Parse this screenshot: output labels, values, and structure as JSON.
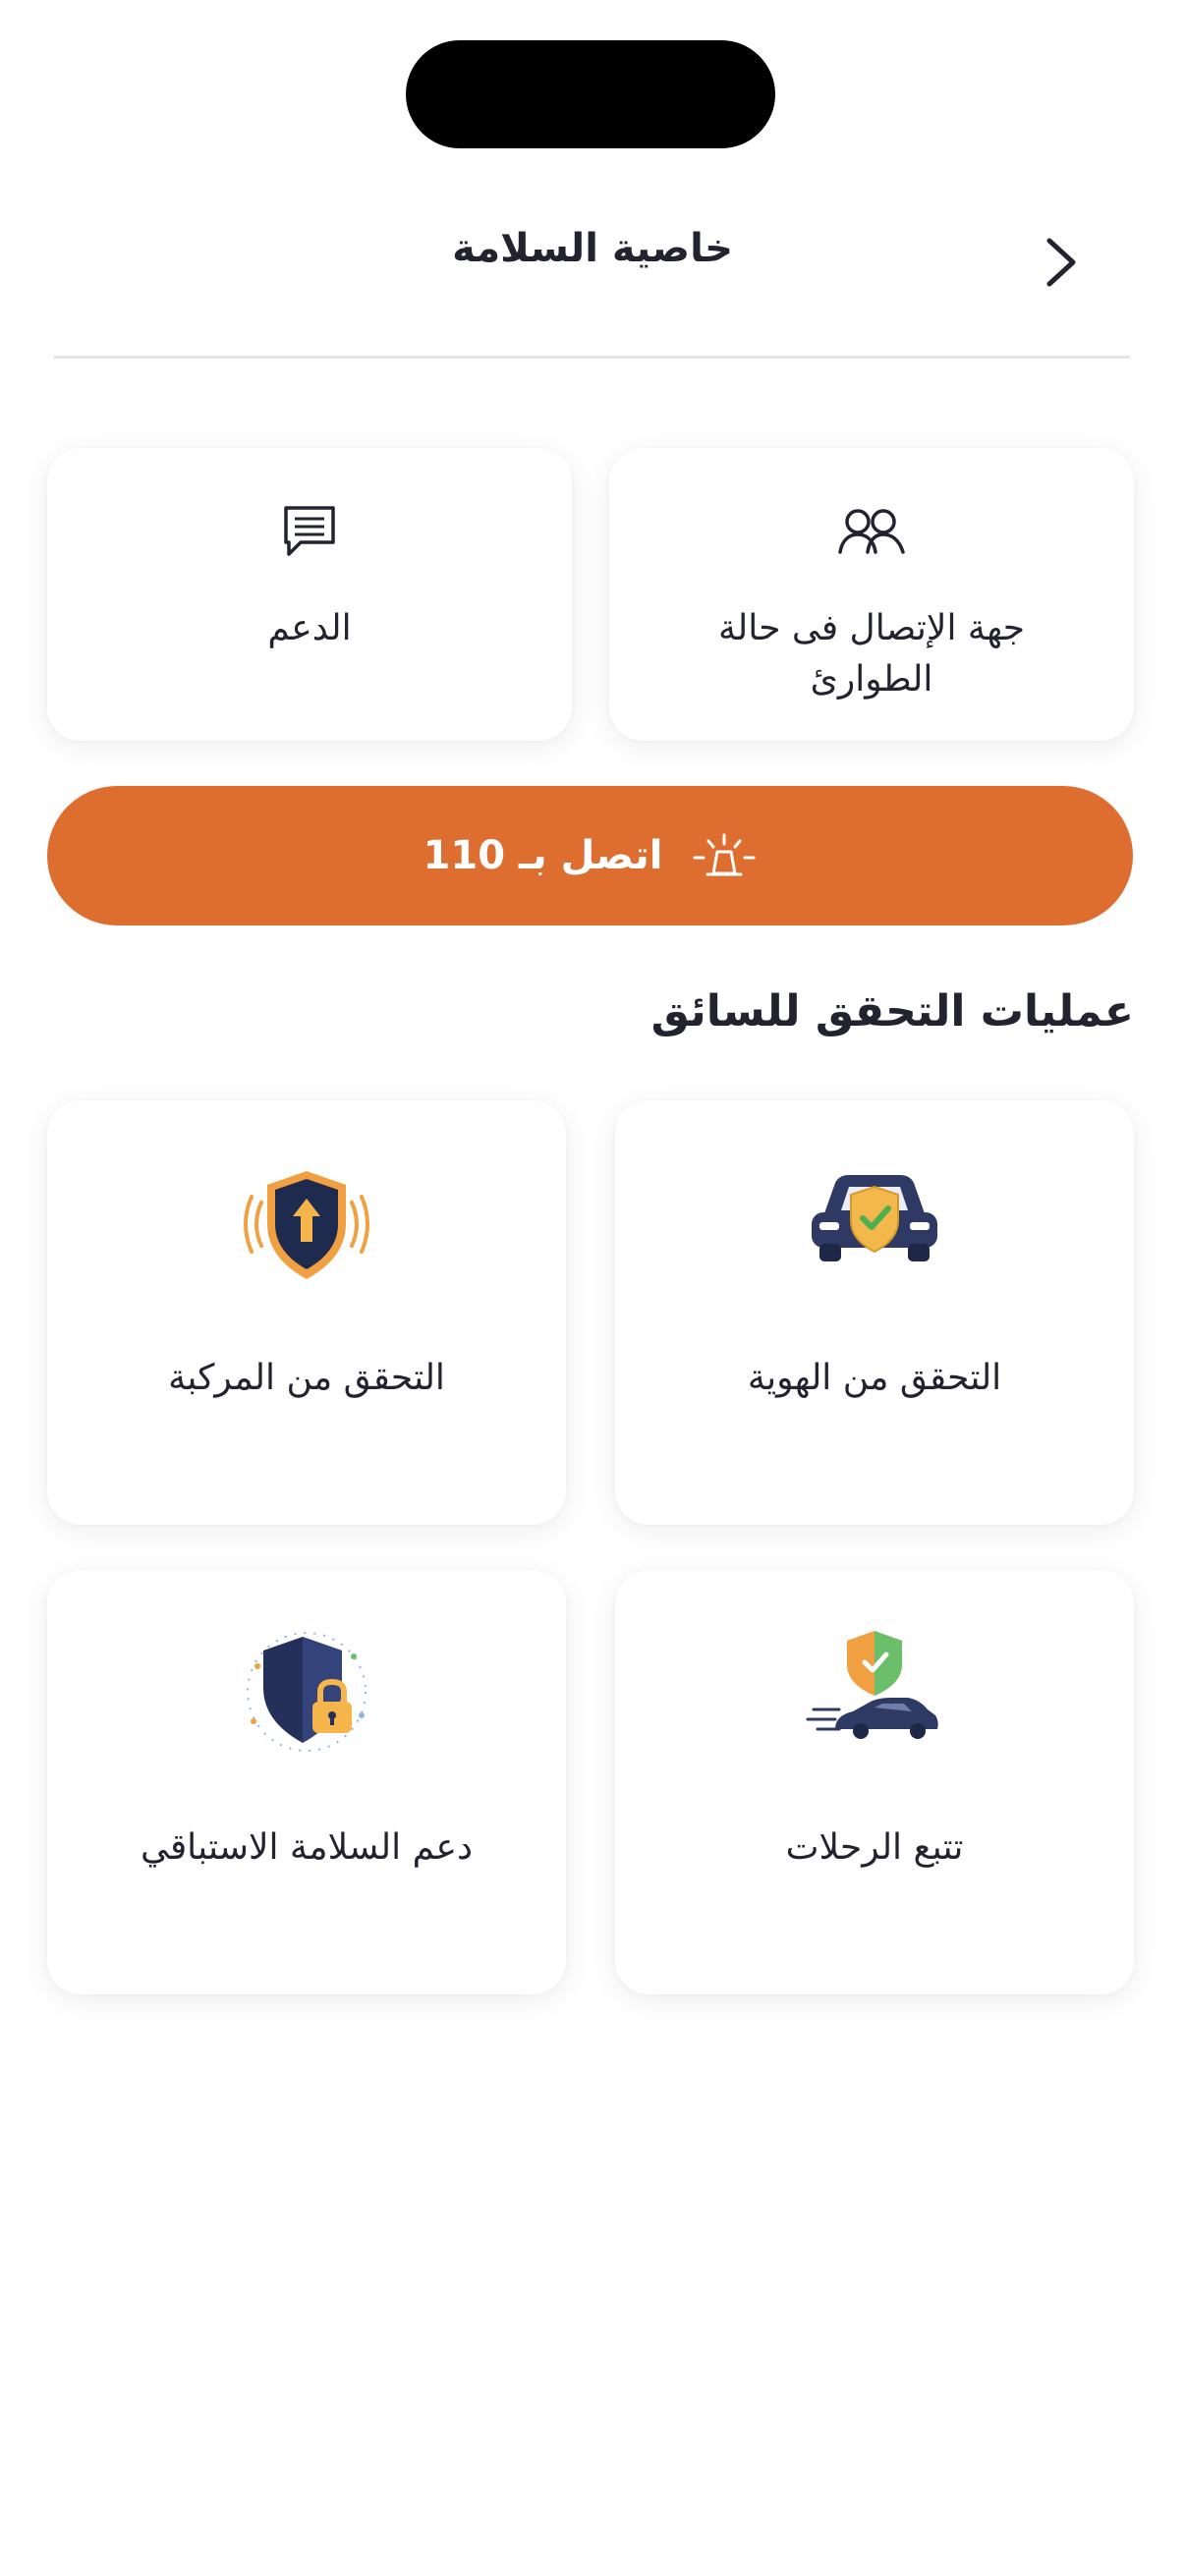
{
  "header": {
    "title": "خاصية السلامة"
  },
  "quick_actions": [
    {
      "label": "جهة الإتصال فى حالة الطوارئ",
      "icon": "contacts-icon"
    },
    {
      "label": "الدعم",
      "icon": "chat-icon"
    }
  ],
  "emergency": {
    "label": "اتصل بـ 110",
    "icon": "siren-icon",
    "color": "#dd6e30"
  },
  "section": {
    "title": "عمليات التحقق للسائق"
  },
  "verifications": [
    {
      "label": "التحقق من الهوية",
      "icon": "car-shield-icon"
    },
    {
      "label": "التحقق من المركبة",
      "icon": "shield-arrow-icon"
    },
    {
      "label": "تتبع الرحلات",
      "icon": "car-tracking-icon"
    },
    {
      "label": "دعم السلامة الاستباقي",
      "icon": "shield-lock-icon"
    }
  ]
}
